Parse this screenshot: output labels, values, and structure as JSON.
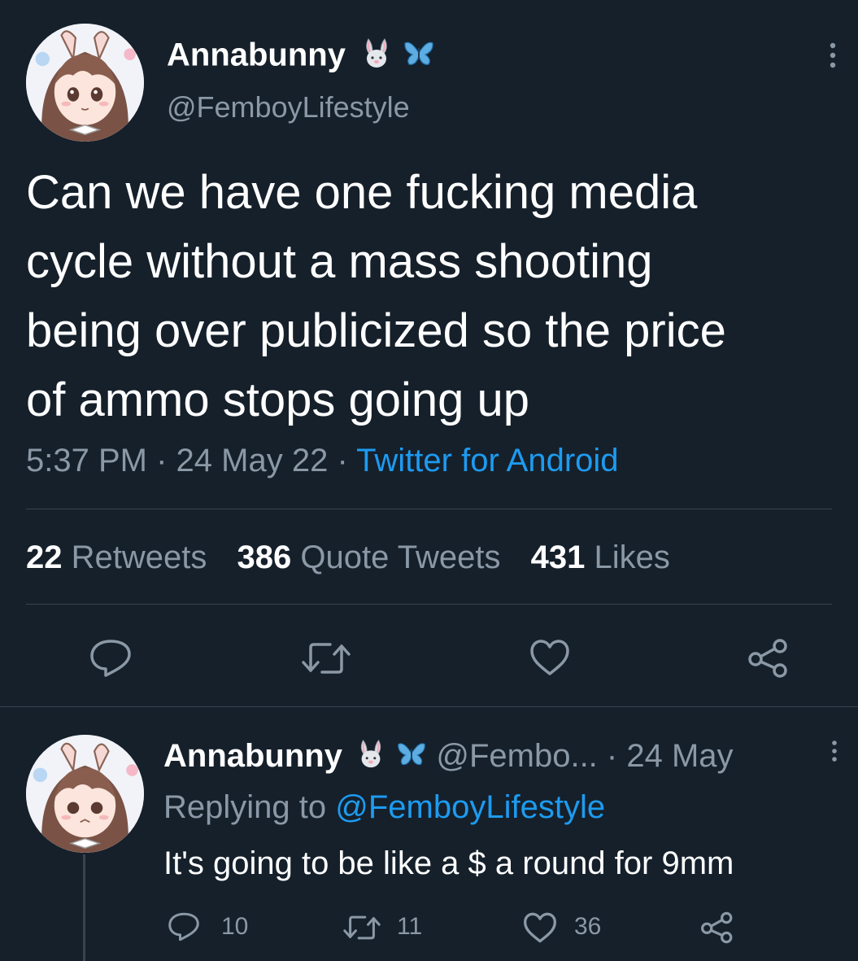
{
  "main_tweet": {
    "display_name": "Annabunny",
    "handle": "@FemboyLifestyle",
    "name_emojis": [
      "rabbit-face",
      "butterfly"
    ],
    "text_lines": [
      "Can we have one fucking media",
      "cycle without a mass shooting",
      "being over publicized so the price",
      "of ammo stops going up"
    ],
    "time": "5:37 PM",
    "sep1": "·",
    "date": "24 May 22",
    "sep2": "·",
    "source": "Twitter for Android",
    "stats": {
      "retweets_count": "22",
      "retweets_label": "Retweets",
      "quotes_count": "386",
      "quotes_label": "Quote Tweets",
      "likes_count": "431",
      "likes_label": "Likes"
    }
  },
  "reply_tweet": {
    "display_name": "Annabunny",
    "handle": "@Fembo...",
    "sep": "·",
    "date": "24 May",
    "replying_label": "Replying to",
    "replying_handle": "@FemboyLifestyle",
    "text": "It's going to be like a $ a round for 9mm",
    "reply_count": "10",
    "retweet_count": "11",
    "like_count": "36"
  },
  "colors": {
    "background": "#15202b",
    "accent": "#1d9bf0",
    "muted": "#8b98a5",
    "divider": "#38444d"
  }
}
